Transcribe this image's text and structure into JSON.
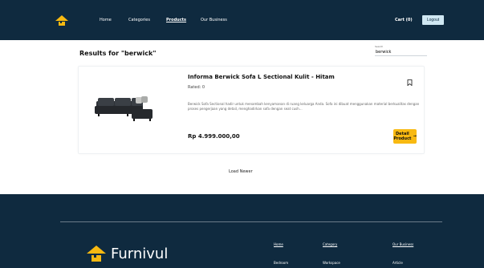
{
  "header": {
    "nav": [
      "Home",
      "Categories",
      "Products",
      "Our Business"
    ],
    "cart_label": "Cart (0)",
    "logout_label": "Logout"
  },
  "results": {
    "title": "Results for \"berwick\"",
    "search_label": "Search",
    "search_value": "berwick"
  },
  "product": {
    "title": "Informa Berwick Sofa L Sectional Kulit - Hitam",
    "rating": "Rated: 0",
    "description": "Berwick Sofa Sectional hadir untuk menambah kenyamanan di ruang keluarga Anda. Sofa ini dibuat menggunakan material berkualitas dengan proses pengerjaan yang detail, menghadirkan sofa dengan seat cush...",
    "price": "Rp 4.999.000,00",
    "detail_button_label": "Detail Product",
    "detail_button_arrow": "→",
    "image_icon": "sofa-image",
    "bookmark_icon": "bookmark-icon"
  },
  "load_newer_label": "Load Newer",
  "footer": {
    "brand": "Furnivul",
    "columns": [
      {
        "head": "Home",
        "item": "Bedroom"
      },
      {
        "head": "Category",
        "item": "Workspace"
      },
      {
        "head": "Our Business",
        "item": "Article"
      }
    ]
  },
  "colors": {
    "navy": "#0f2a3f",
    "accent_yellow": "#f8b911",
    "logout_bg": "#cfe7f2"
  }
}
